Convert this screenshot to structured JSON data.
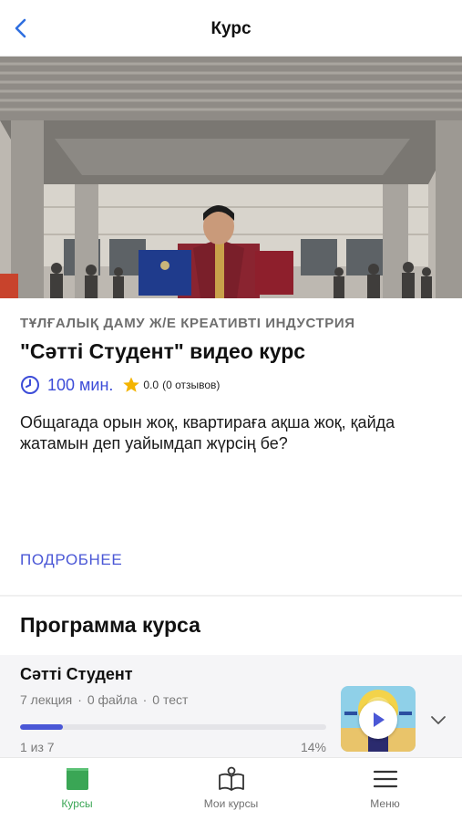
{
  "header": {
    "title": "Курс"
  },
  "course": {
    "category": "ТҰЛҒАЛЫҚ ДАМУ Ж/Е КРЕАТИВТІ ИНДУСТРИЯ",
    "title": "\"Сәтті Студент\" видео курс",
    "duration": "100 мин.",
    "rating": "0.0",
    "reviews": "(0 отзывов)",
    "description": "Общагада орын жоқ, квартираға ақша жоқ, қайда жатамын деп уайымдап жүрсің бе?",
    "more_label": "ПОДРОБНЕЕ",
    "accent_color": "#4a57d6"
  },
  "program": {
    "title": "Программа курса",
    "modules": [
      {
        "title": "Сәтті Студент",
        "lectures": "7 лекция",
        "files": "0 файла",
        "tests": "0 тест",
        "separator": "·",
        "progress_fraction": 0.14,
        "progress_count": "1 из 7",
        "progress_percent": "14%"
      }
    ]
  },
  "tabbar": {
    "items": [
      {
        "label": "Курсы",
        "icon": "book-filled-icon",
        "active": true
      },
      {
        "label": "Мои курсы",
        "icon": "open-book-icon",
        "active": false
      },
      {
        "label": "Меню",
        "icon": "hamburger-icon",
        "active": false
      }
    ],
    "active_color": "#3aa655"
  }
}
